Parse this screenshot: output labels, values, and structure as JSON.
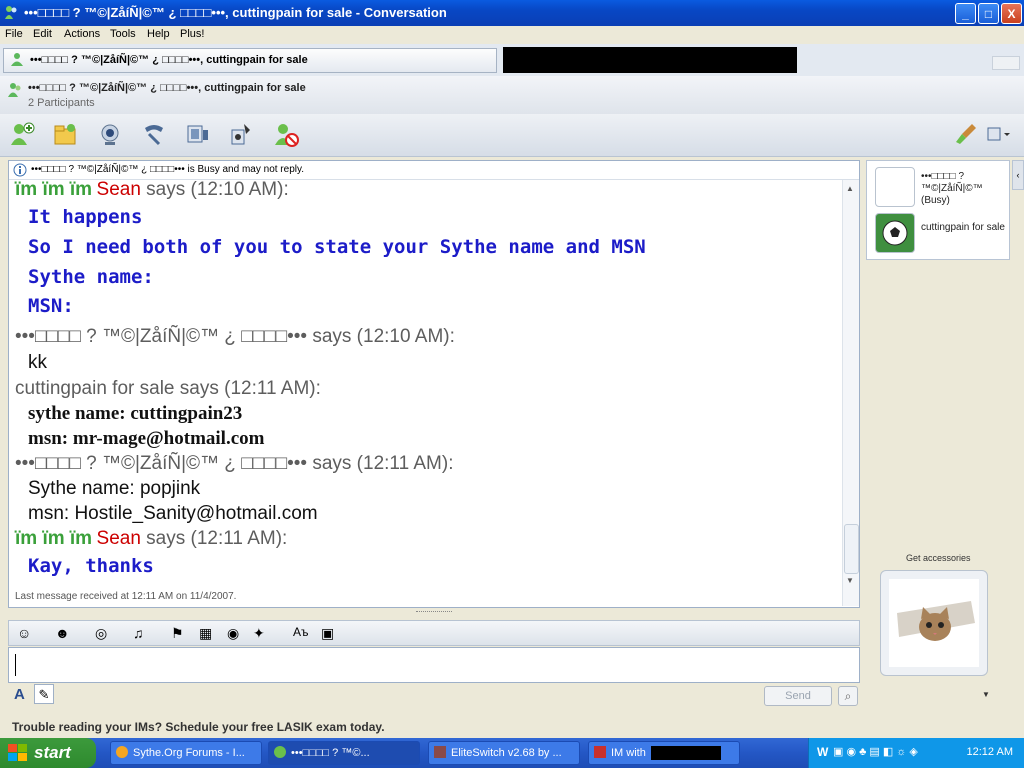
{
  "window": {
    "title": "•••□□□□  ?  ™©|ZåíÑ|©™  ¿  □□□□•••, cuttingpain for sale - Conversation",
    "min": "_",
    "max": "□",
    "close": "X"
  },
  "menu": [
    "File",
    "Edit",
    "Actions",
    "Tools",
    "Help",
    "Plus!"
  ],
  "tab": {
    "label": "•••□□□□  ?  ™©|ZåíÑ|©™  ¿  □□□□•••, cuttingpain for sale"
  },
  "header": {
    "name": "•••□□□□  ?  ™©|ZåíÑ|©™  ¿  □□□□•••, cuttingpain for sale",
    "participants": "2 Participants"
  },
  "toolbar_icons": [
    "invite-contact-icon",
    "send-files-icon",
    "webcam-icon",
    "call-icon",
    "video-icon",
    "games-icon",
    "block-icon"
  ],
  "infobar": {
    "text": "•••□□□□  ?  ™©|ZåíÑ|©™  ¿  □□□□••• is Busy and may not reply."
  },
  "messages": {
    "m1_prefix": "ïm ïm ïm",
    "m1_name": "Sean",
    "m1_says": " says (12:10 AM):",
    "m1_l1": "It happens",
    "m1_l2": "So I need both of you to state your Sythe name and MSN",
    "m1_l3": "Sythe name:",
    "m1_l4": "MSN:",
    "m2_header": "•••□□□□  ?  ™©|ZåíÑ|©™  ¿  □□□□••• says (12:10 AM):",
    "m2_l1": "kk",
    "m3_header": "cuttingpain for sale says (12:11 AM):",
    "m3_l1": "sythe name: cuttingpain23",
    "m3_l2": "msn: mr-mage@hotmail.com",
    "m4_header": "•••□□□□  ?  ™©|ZåíÑ|©™  ¿  □□□□••• says (12:11 AM):",
    "m4_l1": "Sythe name: popjink",
    "m4_l2": "msn: Hostile_Sanity@hotmail.com",
    "m5_prefix": "ïm ïm ïm",
    "m5_name": "Sean",
    "m5_says": " says (12:11 AM):",
    "m5_l1": "Kay, thanks"
  },
  "last_message": "Last message received at 12:11 AM on 11/4/2007.",
  "send_button": "Send",
  "participants": [
    {
      "name": "•••□□□□  ?  ™©|ZåíÑ|©™  (Busy)"
    },
    {
      "name": "cuttingpain for sale"
    }
  ],
  "accessories_label": "Get accessories",
  "ad_text": "Trouble reading your IMs? Schedule your free LASIK exam today.",
  "taskbar": {
    "start": "start",
    "tasks": [
      "Sythe.Org Forums - I...",
      "•••□□□□  ?  ™©...",
      "EliteSwitch v2.68 by ...",
      "IM with"
    ],
    "clock": "12:12 AM"
  },
  "colors": {
    "sender_sean": "#cc0000",
    "msg_blue": "#1c1cc8",
    "title_blue": "#0a5be0",
    "start_green": "#3c9a3c"
  }
}
